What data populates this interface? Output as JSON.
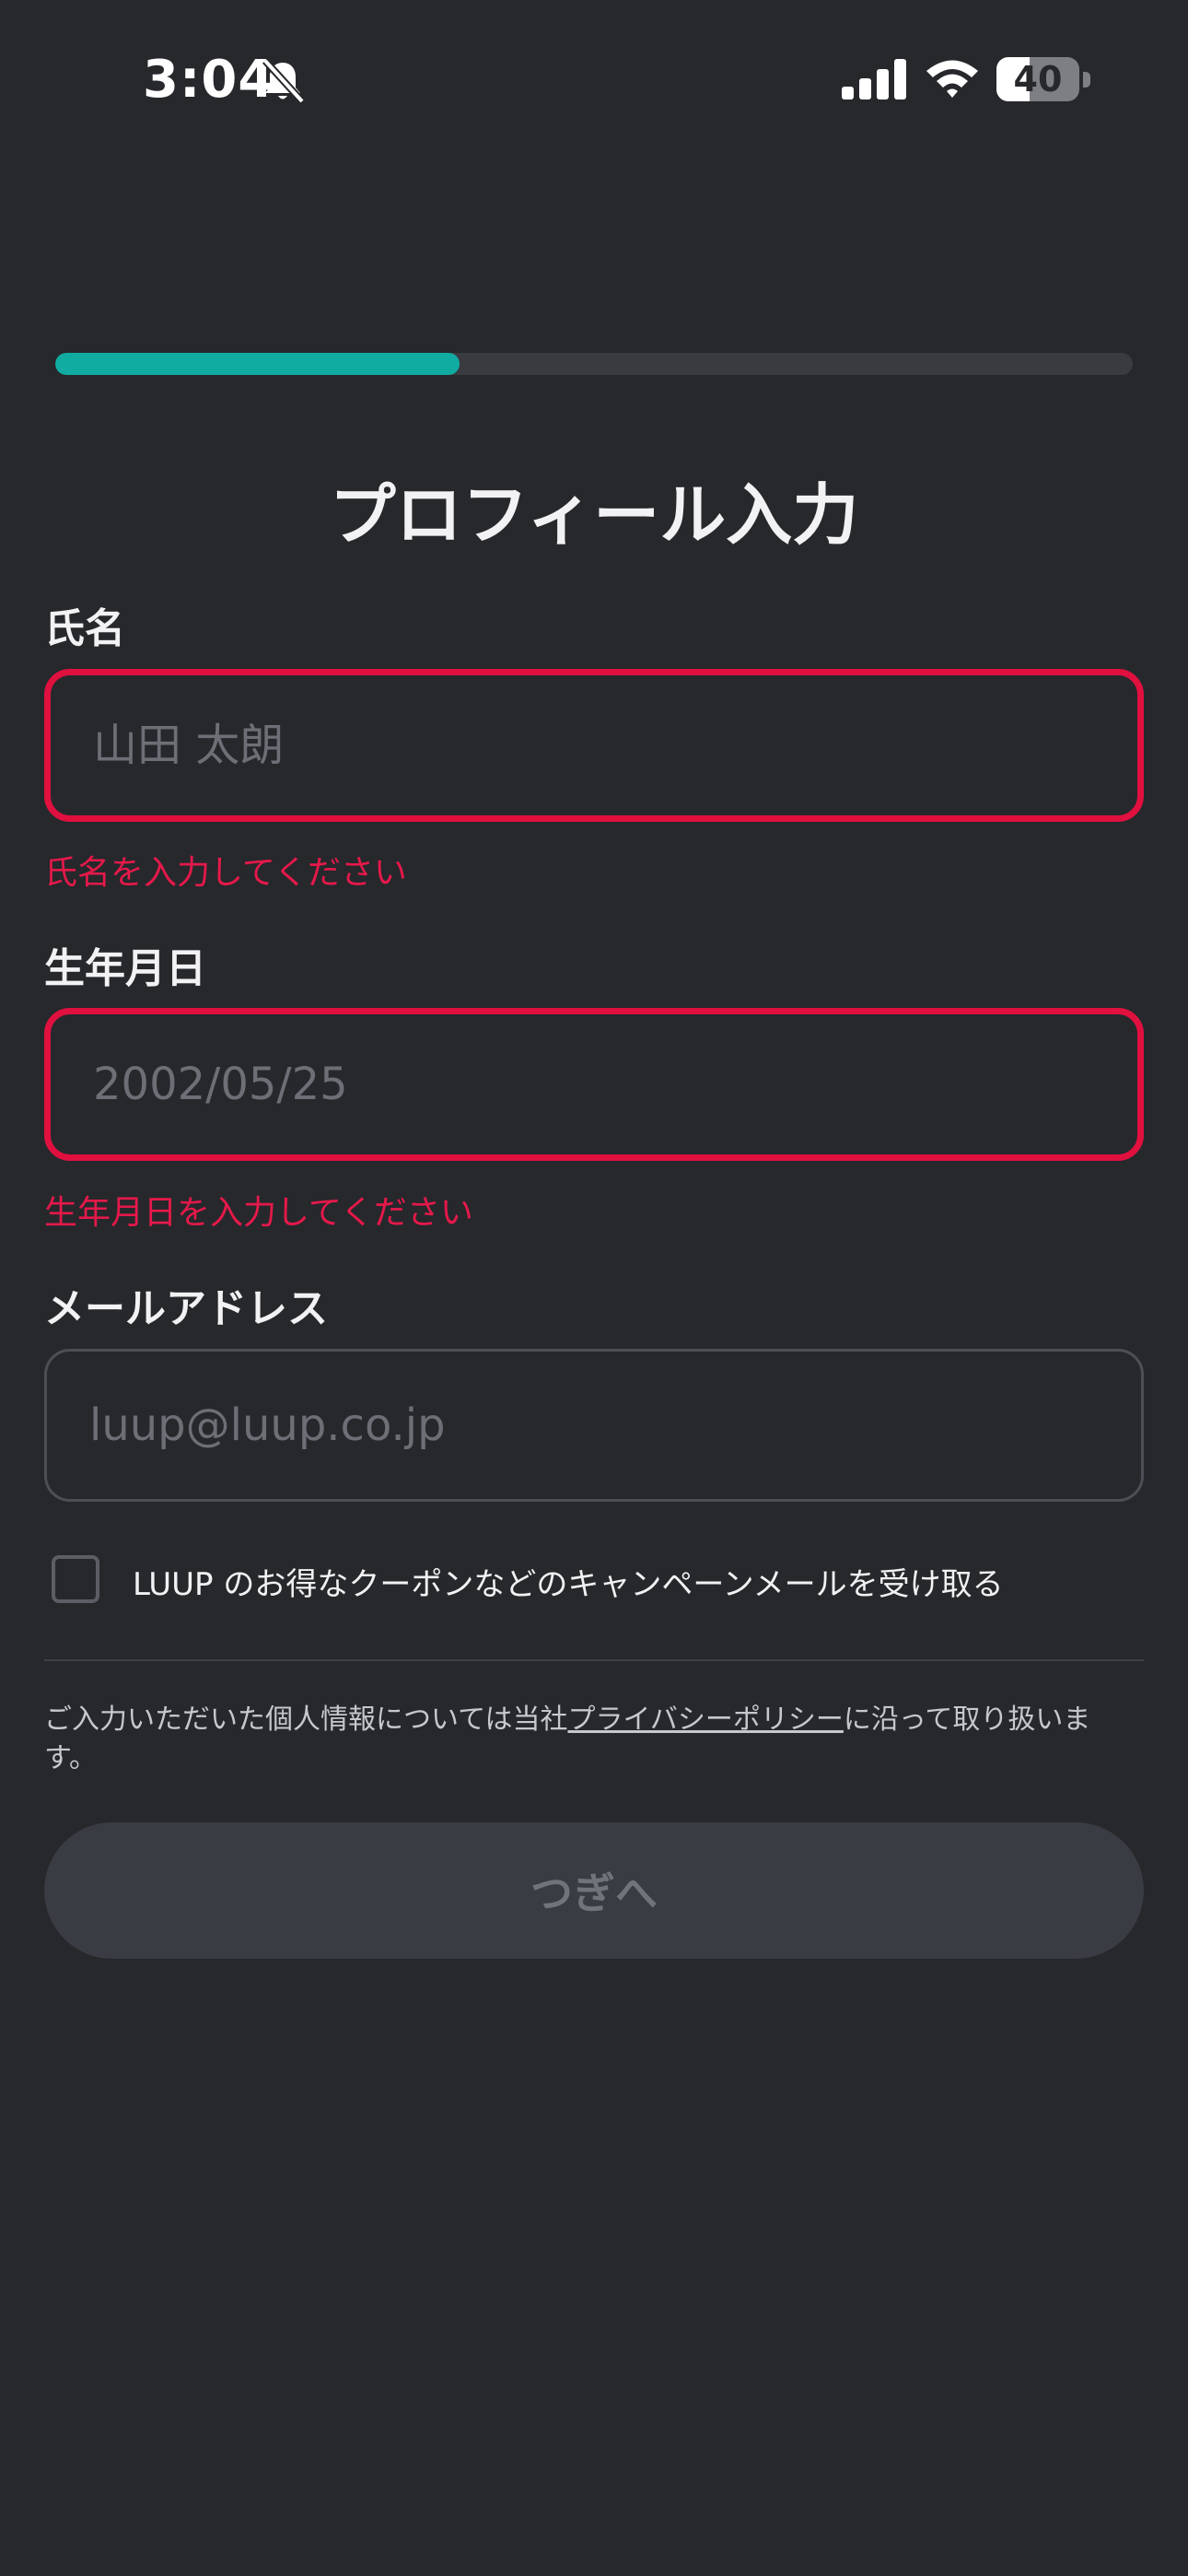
{
  "status_bar": {
    "time": "3:04",
    "battery_level": "40",
    "battery_fraction": 0.4
  },
  "progress": {
    "fraction": 0.375
  },
  "title": "プロフィール入力",
  "fields": {
    "name": {
      "label": "氏名",
      "placeholder": "山田 太朗",
      "value": "",
      "error": "氏名を入力してください"
    },
    "birthdate": {
      "label": "生年月日",
      "placeholder": "2002/05/25",
      "value": "",
      "error": "生年月日を入力してください"
    },
    "email": {
      "label": "メールアドレス",
      "placeholder": "luup@luup.co.jp",
      "value": ""
    }
  },
  "campaign_checkbox": {
    "label": "LUUP のお得なクーポンなどのキャンペーンメールを受け取る",
    "checked": false
  },
  "privacy_notice": {
    "before": "ご入力いただいた個人情報については当社",
    "link": "プライバシーポリシー",
    "after": "に沿って取り扱います。"
  },
  "next_button": {
    "label": "つぎへ",
    "enabled": false
  },
  "colors": {
    "background": "#26282c",
    "accent": "#10aca2",
    "error": "#e0103f",
    "button_disabled": "#393c42"
  }
}
